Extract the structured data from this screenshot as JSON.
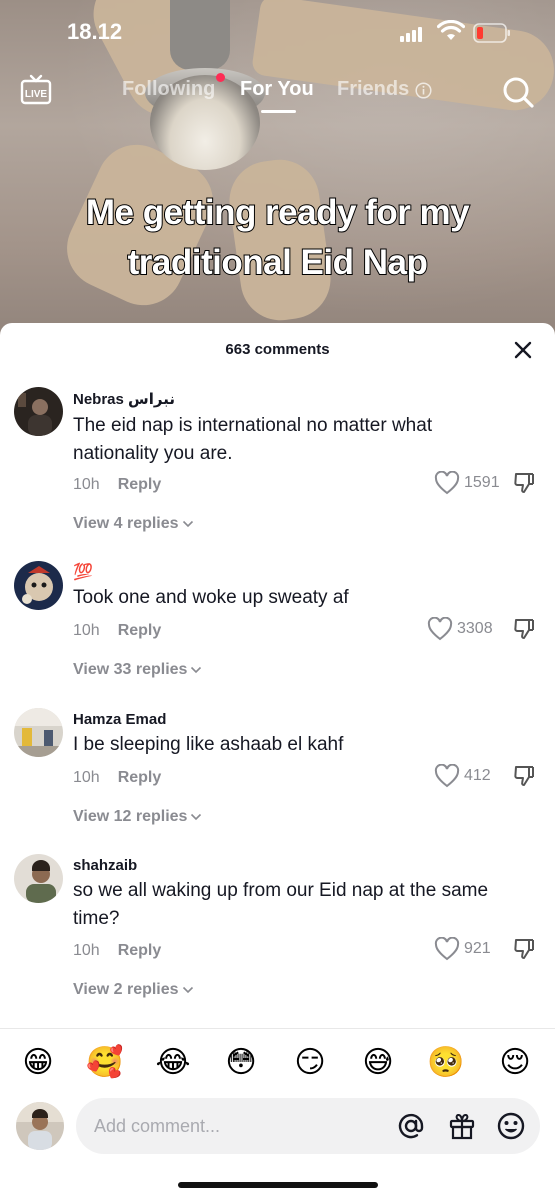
{
  "status_bar": {
    "time": "18.12"
  },
  "top_nav": {
    "live_label": "LIVE",
    "tabs": [
      {
        "label": "Following",
        "has_dot": true
      },
      {
        "label": "For You",
        "active": true
      },
      {
        "label": "Friends"
      }
    ]
  },
  "video": {
    "caption_line1": "Me getting ready for my",
    "caption_line2": "traditional Eid Nap"
  },
  "comments_sheet": {
    "title": "663 comments",
    "comments": [
      {
        "user": "Nebras نبراس",
        "text": "The eid nap is international no matter what nationality you are.",
        "time": "10h",
        "reply": "Reply",
        "likes": "1591",
        "view_replies": "View 4 replies"
      },
      {
        "user": "💯",
        "text": "Took one and woke up sweaty af",
        "time": "10h",
        "reply": "Reply",
        "likes": "3308",
        "view_replies": "View 33 replies"
      },
      {
        "user": "Hamza Emad",
        "text": "I be sleeping like ashaab el kahf",
        "time": "10h",
        "reply": "Reply",
        "likes": "412",
        "view_replies": "View 12 replies"
      },
      {
        "user": "shahzaib",
        "text": "so we all waking up from our Eid nap at the same time?",
        "time": "10h",
        "reply": "Reply",
        "likes": "921",
        "view_replies": "View 2 replies"
      }
    ]
  },
  "emoji_bar": [
    "😁",
    "🥰",
    "😂",
    "😳",
    "😏",
    "😅",
    "🥺",
    "😌"
  ],
  "composer": {
    "placeholder": "Add comment..."
  },
  "colors": {
    "accent": "#fe2c55",
    "text": "#161823",
    "muted": "#8a8b91"
  }
}
